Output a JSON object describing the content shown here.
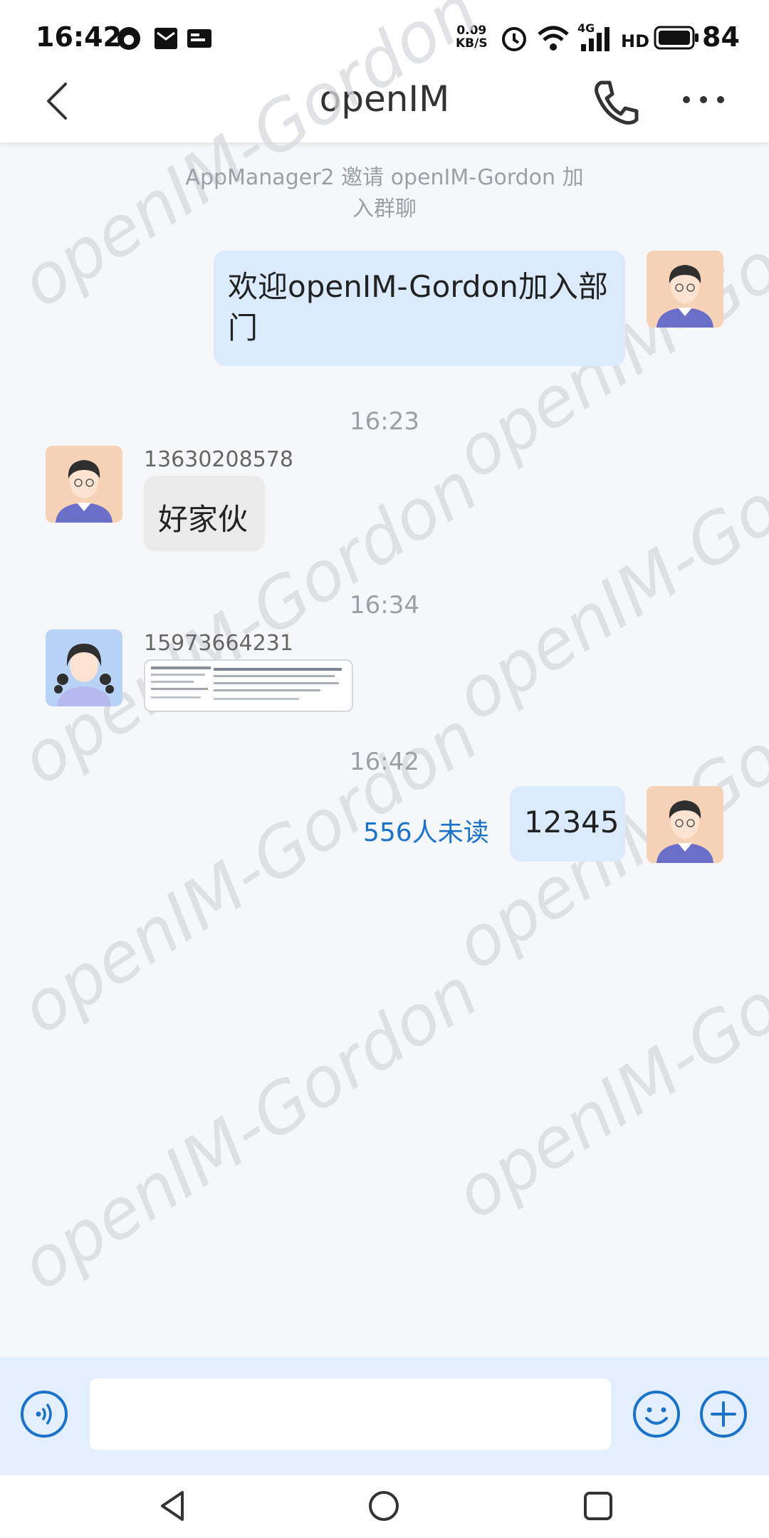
{
  "status_bar": {
    "time": "16:42",
    "net_speed_value": "0.09",
    "net_speed_unit": "KB/S",
    "signal_type": "4G",
    "hd_label": "HD",
    "battery": "84"
  },
  "header": {
    "title": "openIM",
    "back_icon": "chevron-left-icon",
    "call_icon": "phone-icon",
    "more_icon": "more-horizontal-icon"
  },
  "watermark": "openIM-Gordon",
  "messages": {
    "system_notice": "AppManager2 邀请 openIM-Gordon 加入群聊",
    "msg1": {
      "text": "欢迎openIM-Gordon加入部门"
    },
    "time1": "16:23",
    "msg2": {
      "sender": "13630208578",
      "text": "好家伙"
    },
    "time2": "16:34",
    "msg3": {
      "sender": "15973664231"
    },
    "time3": "16:42",
    "msg4": {
      "text": "12345",
      "unread": "556人未读"
    }
  },
  "input_bar": {
    "voice_icon": "voice-icon",
    "emoji_icon": "emoji-icon",
    "add_icon": "add-circle-icon",
    "placeholder": ""
  },
  "colors": {
    "accent": "#1a73c8",
    "bubble_self": "#dceafe",
    "bubble_other": "#ebebec",
    "input_bar_bg": "#e3efff"
  }
}
